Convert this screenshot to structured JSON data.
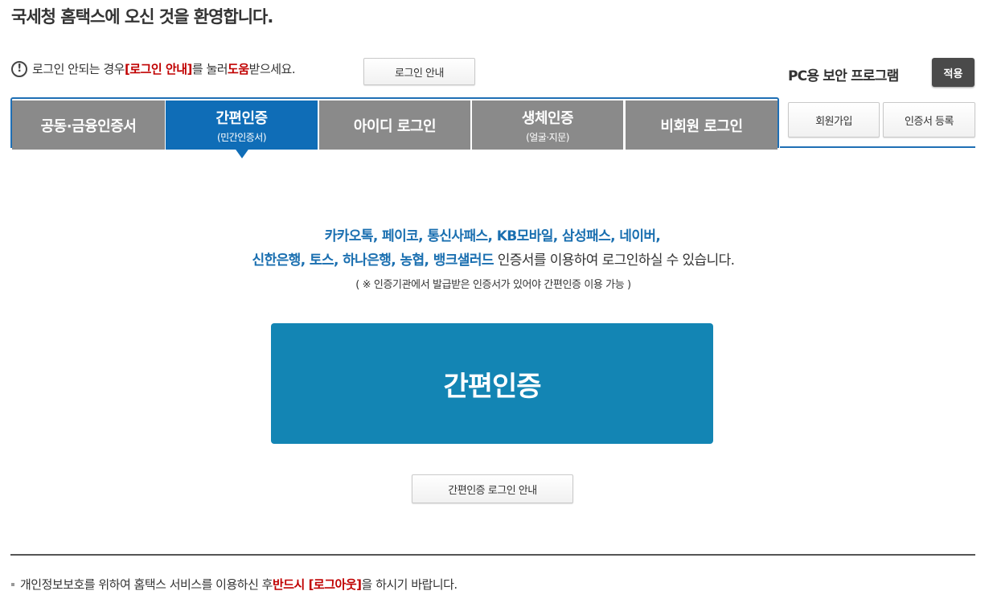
{
  "header": {
    "welcome": "국세청 홈택스에 오신 것을 환영합니다."
  },
  "notice": {
    "icon": "exclamation-circle-icon",
    "text1": "로그인 안되는 경우 ",
    "highlight1": "[로그인 안내]",
    "text2": "를 눌러 ",
    "highlight2": "도움",
    "text3": "받으세요.",
    "button": "로그인 안내"
  },
  "security": {
    "label": "PC용 보안 프로그램",
    "apply": "적용"
  },
  "tabs": [
    {
      "label": "공동·금융인증서",
      "sub": ""
    },
    {
      "label": "간편인증",
      "sub": "(민간인증서)"
    },
    {
      "label": "아이디 로그인",
      "sub": ""
    },
    {
      "label": "생체인증",
      "sub": "(얼굴·지문)"
    },
    {
      "label": "비회원 로그인",
      "sub": ""
    }
  ],
  "side_buttons": {
    "signup": "회원가입",
    "cert_register": "인증서 등록"
  },
  "main": {
    "providers_line1": "카카오톡, 페이코, 통신사패스, KB모바일, 삼성패스, 네이버,",
    "providers_line2": "신한은행, 토스, 하나은행, 농협, 뱅크샐러드",
    "providers_line2_suffix": " 인증서를 이용하여 로그인하실 수 있습니다.",
    "note": "( ※ 인증기관에서 발급받은 인증서가 있어야 간편인증 이용 가능 )",
    "big_button": "간편인증",
    "guide_button": "간편인증 로그인 안내"
  },
  "footer": {
    "text1": "개인정보보호를 위하여 홈택스 서비스를 이용하신 후 ",
    "highlight": "반드시 [로그아웃]",
    "text2": "을 하시기 바랍니다."
  },
  "colors": {
    "active_tab": "#0f6db7",
    "inactive_tab": "#8a8a8a",
    "big_button": "#1385b4",
    "highlight_red": "#c00000",
    "provider_blue": "#1a6fb0"
  }
}
